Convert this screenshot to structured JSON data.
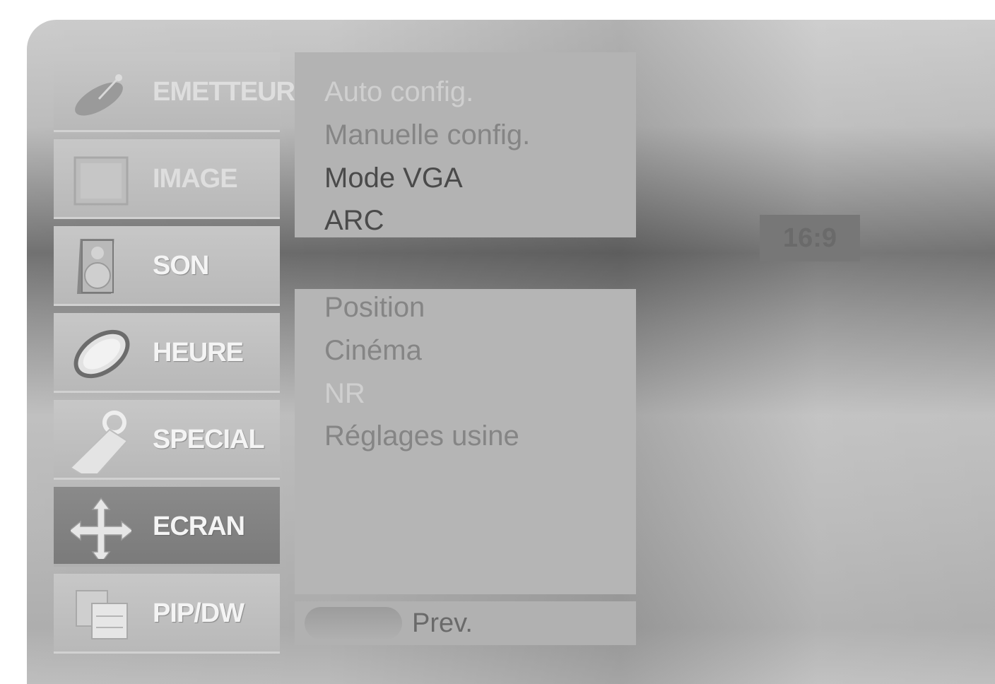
{
  "menu": {
    "items": [
      {
        "label": "EMETTEUR",
        "icon": "satellite-dish-icon"
      },
      {
        "label": "IMAGE",
        "icon": "picture-icon"
      },
      {
        "label": "SON",
        "icon": "speaker-icon"
      },
      {
        "label": "HEURE",
        "icon": "clock-icon"
      },
      {
        "label": "SPECIAL",
        "icon": "tag-icon"
      },
      {
        "label": "ECRAN",
        "icon": "move-arrows-icon"
      },
      {
        "label": "PIP/DW",
        "icon": "pip-windows-icon"
      }
    ],
    "active_index": 5
  },
  "submenu_top": {
    "items": [
      "Auto config.",
      "Manuelle config.",
      "Mode VGA",
      "ARC"
    ]
  },
  "submenu_bottom": {
    "items": [
      "Position",
      "Cinéma",
      "NR",
      "Réglages usine"
    ]
  },
  "footer": {
    "prev_label": "Prev."
  },
  "value_box": {
    "text": "16:9"
  }
}
